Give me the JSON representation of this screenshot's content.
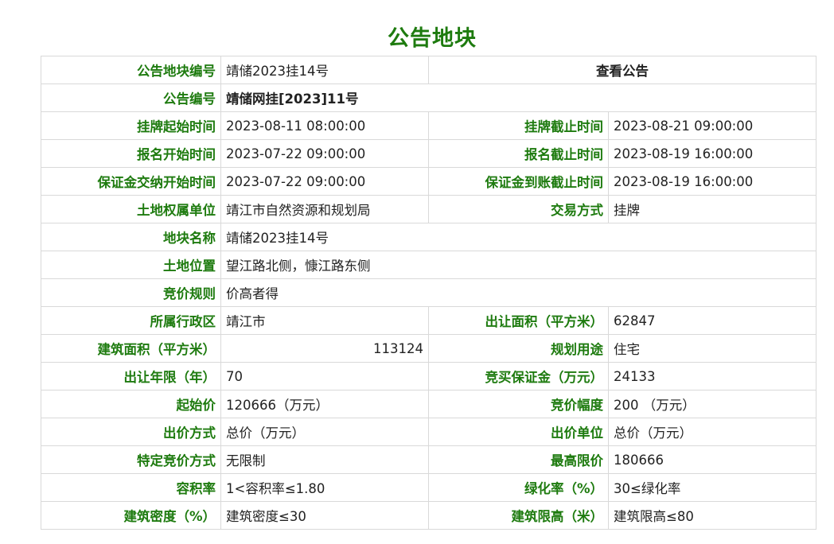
{
  "page_title": "公告地块",
  "view_notice_label": "查看公告",
  "rows": {
    "parcel_no": {
      "label": "公告地块编号",
      "value": "靖储2023挂14号"
    },
    "notice_no": {
      "label": "公告编号",
      "value": "靖储网挂[2023]11号"
    },
    "listing_start": {
      "label": "挂牌起始时间",
      "value": "2023-08-11 08:00:00"
    },
    "listing_end": {
      "label": "挂牌截止时间",
      "value": "2023-08-21 09:00:00"
    },
    "signup_start": {
      "label": "报名开始时间",
      "value": "2023-07-22 09:00:00"
    },
    "signup_end": {
      "label": "报名截止时间",
      "value": "2023-08-19 16:00:00"
    },
    "deposit_start": {
      "label": "保证金交纳开始时间",
      "value": "2023-07-22 09:00:00"
    },
    "deposit_end": {
      "label": "保证金到账截止时间",
      "value": "2023-08-19 16:00:00"
    },
    "owner": {
      "label": "土地权属单位",
      "value": "靖江市自然资源和规划局"
    },
    "trade_mode": {
      "label": "交易方式",
      "value": "挂牌"
    },
    "parcel_name": {
      "label": "地块名称",
      "value": "靖储2023挂14号"
    },
    "location": {
      "label": "土地位置",
      "value": "望江路北侧，慷江路东侧"
    },
    "bid_rule": {
      "label": "竞价规则",
      "value": "价高者得"
    },
    "district": {
      "label": "所属行政区",
      "value": "靖江市"
    },
    "land_area": {
      "label": "出让面积（平方米）",
      "value": "62847"
    },
    "building_area": {
      "label": "建筑面积（平方米）",
      "value": "113124"
    },
    "planned_use": {
      "label": "规划用途",
      "value": "住宅"
    },
    "term": {
      "label": "出让年限（年）",
      "value": "70"
    },
    "bid_deposit": {
      "label": "竞买保证金（万元）",
      "value": "24133"
    },
    "start_price": {
      "label": "起始价",
      "value": "120666（万元）"
    },
    "increment": {
      "label": "竞价幅度",
      "value": "200 （万元）"
    },
    "bid_method": {
      "label": "出价方式",
      "value": "总价（万元）"
    },
    "bid_unit": {
      "label": "出价单位",
      "value": "总价（万元）"
    },
    "special_bid": {
      "label": "特定竞价方式",
      "value": "无限制"
    },
    "max_price": {
      "label": "最高限价",
      "value": "180666"
    },
    "far": {
      "label": "容积率",
      "value": "1<容积率≤1.80"
    },
    "green_rate": {
      "label": "绿化率（%）",
      "value": "30≤绿化率"
    },
    "density": {
      "label": "建筑密度（%）",
      "value": "建筑密度≤30"
    },
    "height_limit": {
      "label": "建筑限高（米）",
      "value": "建筑限高≤80"
    }
  }
}
